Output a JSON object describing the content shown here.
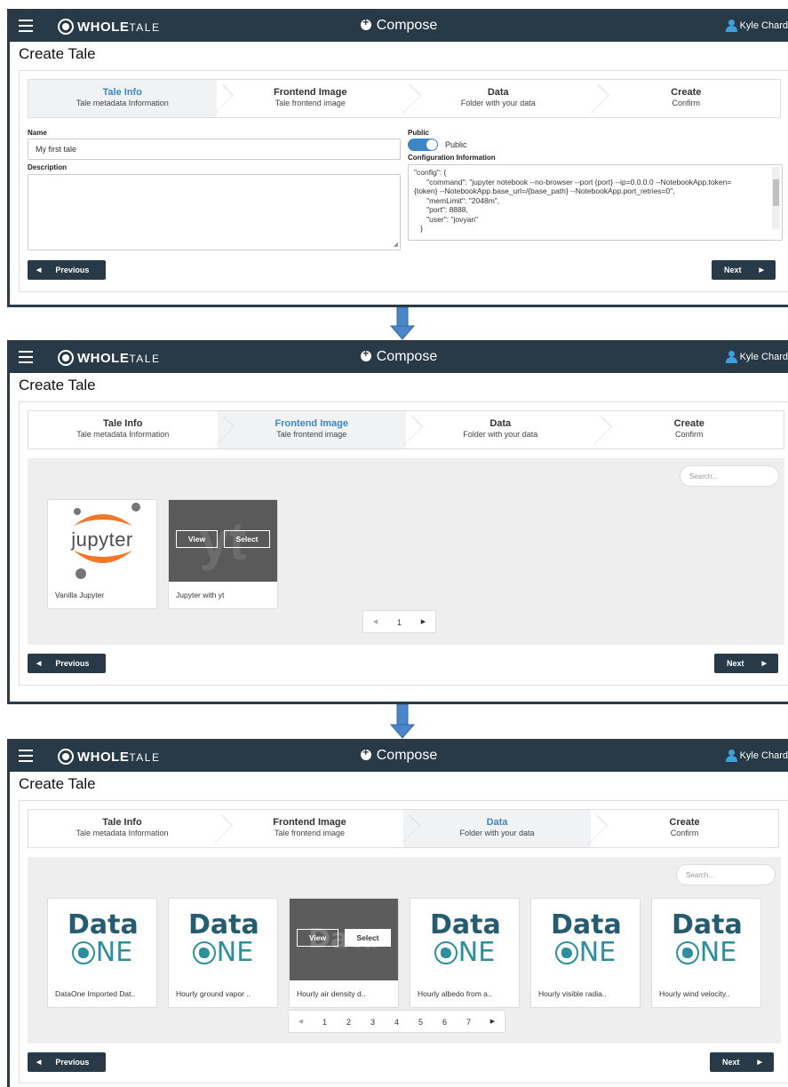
{
  "app": {
    "brand_main": "WHOLE",
    "brand_sub": "TALE",
    "compose_label": "Compose",
    "user_name": "Kyle Chard",
    "page_title": "Create Tale"
  },
  "steps": [
    {
      "title": "Tale Info",
      "subtitle": "Tale metadata Information"
    },
    {
      "title": "Frontend Image",
      "subtitle": "Tale frontend image"
    },
    {
      "title": "Data",
      "subtitle": "Folder with your data"
    },
    {
      "title": "Create",
      "subtitle": "Confirm"
    }
  ],
  "nav": {
    "previous_label": "Previous",
    "next_label": "Next"
  },
  "tale_info": {
    "name_label": "Name",
    "name_value": "My first tale",
    "description_label": "Description",
    "description_value": "",
    "public_label": "Public",
    "public_toggle_label": "Public",
    "public_enabled": true,
    "config_label": "Configuration Information",
    "config_lines": [
      "\"config\": {",
      "      \"command\": \"jupyter notebook --no-browser --port {port} --ip=0.0.0.0 --NotebookApp.token=",
      "{token} --NotebookApp.base_url=/{base_path} --NotebookApp.port_retries=0\",",
      "      \"memLimit\": \"2048m\",",
      "      \"port\": 8888,",
      "      \"user\": \"jovyan\"",
      "   }"
    ]
  },
  "frontend": {
    "search_placeholder": "Search...",
    "images": [
      {
        "label": "Vanilla Jupyter",
        "logo_text": "jupyter"
      },
      {
        "label": "Jupyter with yt",
        "logo_text": "yt",
        "view_label": "View",
        "select_label": "Select"
      }
    ],
    "pages": [
      "1"
    ]
  },
  "data": {
    "search_placeholder": "Search...",
    "logo_top": "Data",
    "logo_bottom": "NE",
    "view_label": "View",
    "select_label": "Select",
    "items": [
      "DataOne Imported Dat..",
      "Hourly ground vapor ..",
      "Hourly air density d..",
      "Hourly albedo from a..",
      "Hourly visible radia..",
      "Hourly wind velocity.."
    ],
    "pages": [
      "1",
      "2",
      "3",
      "4",
      "5",
      "6",
      "7"
    ]
  },
  "colors": {
    "topbar": "#283a47",
    "accent": "#3b86c4",
    "arrow": "#4a86c8",
    "dataone_dark": "#265c72",
    "dataone_teal": "#2c8fa0",
    "jupyter_orange": "#f37726"
  }
}
